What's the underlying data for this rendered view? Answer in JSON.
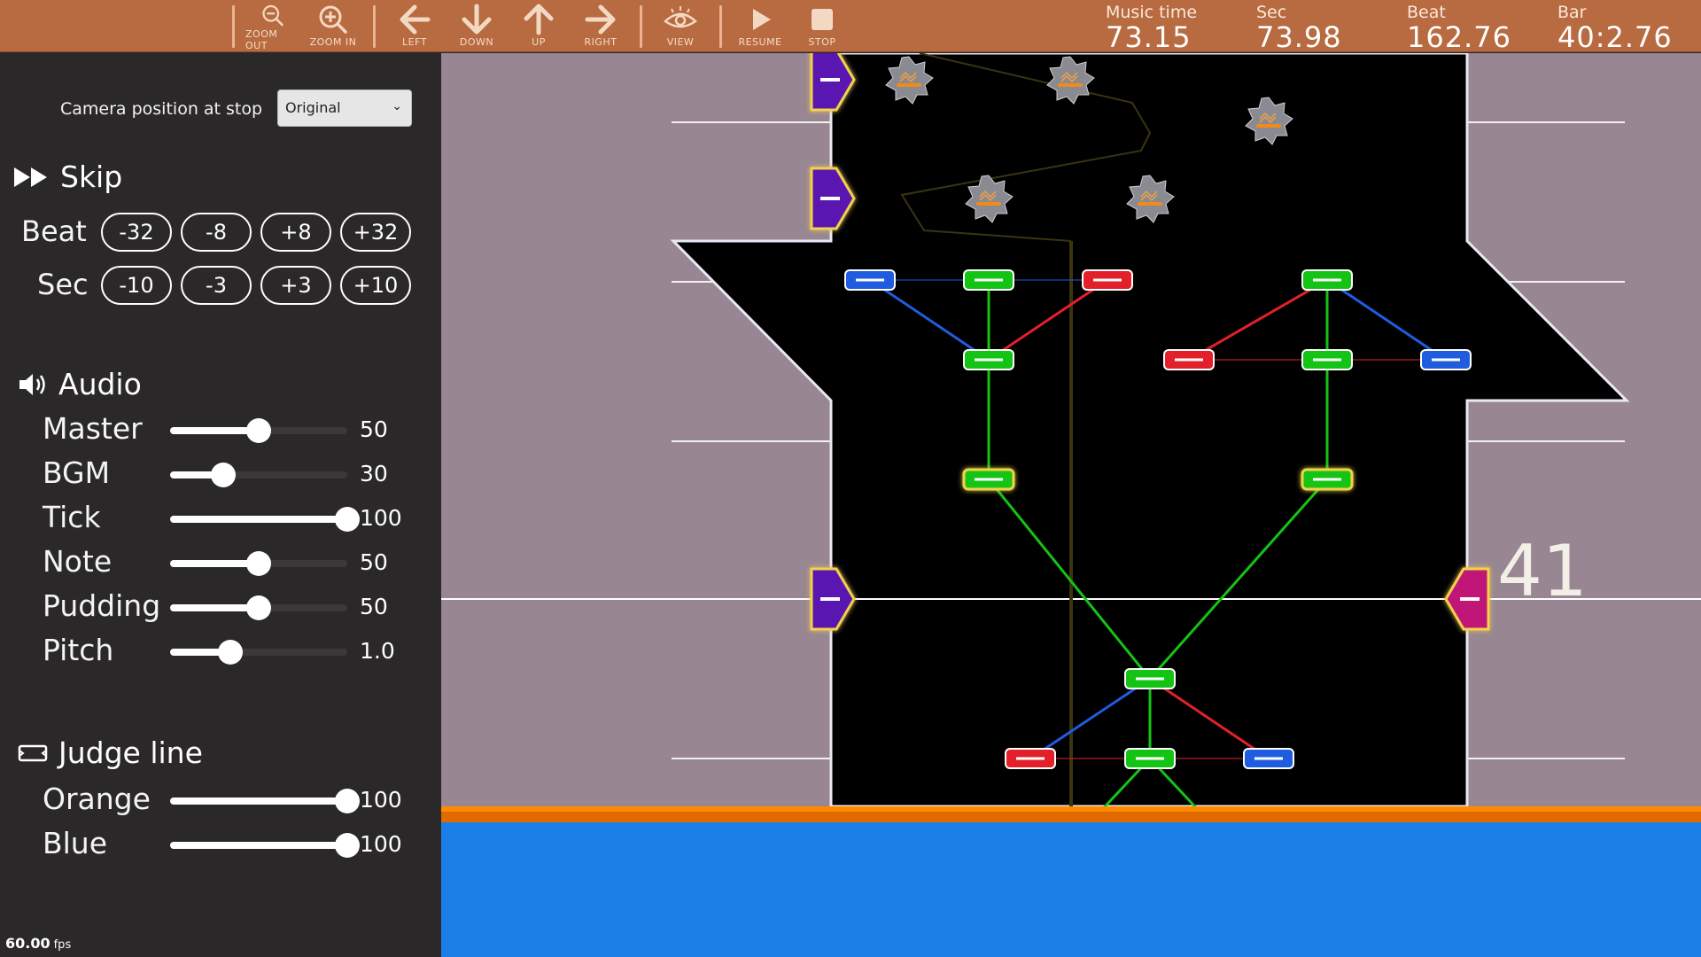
{
  "toolbar": {
    "buttons": [
      {
        "id": "zoom_out",
        "label": "ZOOM OUT",
        "icon": "zoom-out-icon"
      },
      {
        "id": "zoom_in",
        "label": "ZOOM IN",
        "icon": "zoom-in-icon"
      },
      {
        "id": "left",
        "label": "LEFT",
        "icon": "arrow-left-icon"
      },
      {
        "id": "down",
        "label": "DOWN",
        "icon": "arrow-down-icon"
      },
      {
        "id": "up",
        "label": "UP",
        "icon": "arrow-up-icon"
      },
      {
        "id": "right",
        "label": "RIGHT",
        "icon": "arrow-right-icon"
      },
      {
        "id": "view",
        "label": "VIEW",
        "icon": "eye-icon"
      },
      {
        "id": "resume",
        "label": "RESUME",
        "icon": "play-icon"
      },
      {
        "id": "stop",
        "label": "STOP",
        "icon": "stop-icon"
      }
    ],
    "readouts": {
      "music_time": {
        "caption": "Music time",
        "value": "73.15"
      },
      "sec": {
        "caption": "Sec",
        "value": "73.98"
      },
      "beat": {
        "caption": "Beat",
        "value": "162.76"
      },
      "bar": {
        "caption": "Bar",
        "value": "40:2.76"
      }
    },
    "colors": {
      "background": "#b86a40"
    }
  },
  "panel": {
    "camera": {
      "label": "Camera position at stop",
      "value": "Original"
    },
    "skip": {
      "title": "Skip",
      "beat_label": "Beat",
      "beat_buttons": [
        "-32",
        "-8",
        "+8",
        "+32"
      ],
      "sec_label": "Sec",
      "sec_buttons": [
        "-10",
        "-3",
        "+3",
        "+10"
      ]
    },
    "audio": {
      "title": "Audio",
      "sliders": [
        {
          "name": "Master",
          "value": "50",
          "fraction": 0.5
        },
        {
          "name": "BGM",
          "value": "30",
          "fraction": 0.3
        },
        {
          "name": "Tick",
          "value": "100",
          "fraction": 1.0
        },
        {
          "name": "Note",
          "value": "50",
          "fraction": 0.5
        },
        {
          "name": "Pudding",
          "value": "50",
          "fraction": 0.5
        },
        {
          "name": "Pitch",
          "value": "1.0",
          "fraction": 0.34
        }
      ]
    },
    "judge_line": {
      "title": "Judge line",
      "sliders": [
        {
          "name": "Orange",
          "value": "100",
          "fraction": 1.0
        },
        {
          "name": "Blue",
          "value": "100",
          "fraction": 1.0
        }
      ]
    },
    "fps": {
      "value": "60.00",
      "unit": "fps"
    }
  },
  "game": {
    "bar_number": "41",
    "colors": {
      "field_bg": "#988692",
      "lane": "#000000",
      "note_green": "#14c414",
      "note_red": "#e3202a",
      "note_blue": "#1f5ce0",
      "side_purple": "#5a16b0",
      "side_magenta": "#c01878",
      "judge_orange": "#f07a00",
      "judge_blue": "#1a80e8"
    }
  }
}
